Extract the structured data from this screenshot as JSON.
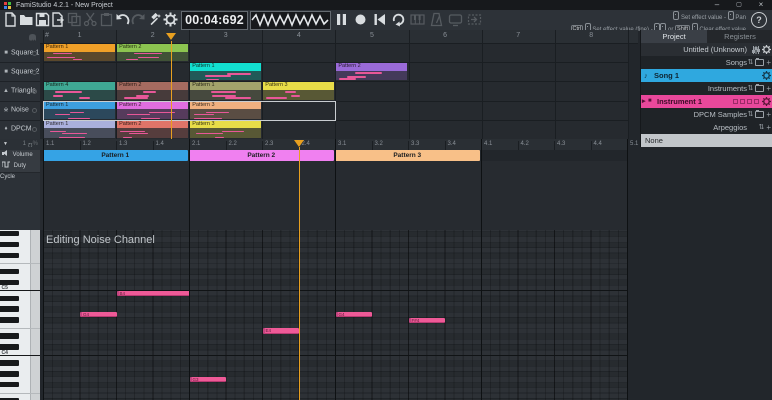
{
  "window": {
    "title": "FamiStudio 4.2.1 - New Project",
    "minimize": "–",
    "maximize": "▢",
    "close": "×"
  },
  "toolbar": {
    "buttons": [
      {
        "name": "new",
        "enabled": true
      },
      {
        "name": "open",
        "enabled": true
      },
      {
        "name": "save",
        "enabled": true
      },
      {
        "name": "export",
        "enabled": true
      },
      {
        "name": "copy",
        "enabled": false
      },
      {
        "name": "cut",
        "enabled": false
      },
      {
        "name": "paste",
        "enabled": false
      },
      {
        "name": "undo",
        "enabled": true
      },
      {
        "name": "redo",
        "enabled": false
      },
      {
        "name": "transform",
        "enabled": true
      },
      {
        "name": "settings",
        "enabled": true
      }
    ],
    "time_display": "00:04:692",
    "transport": [
      {
        "name": "pause",
        "enabled": true
      },
      {
        "name": "record",
        "enabled": true
      },
      {
        "name": "rewind",
        "enabled": true
      },
      {
        "name": "loop",
        "enabled": true
      },
      {
        "name": "qwerty-piano",
        "enabled": false
      },
      {
        "name": "metronome",
        "enabled": false
      },
      {
        "name": "machine",
        "enabled": false
      },
      {
        "name": "follow",
        "enabled": false
      }
    ],
    "hints": {
      "l1_action": "Set effect value",
      "l1_sep": "-",
      "l1_action2": "Pan",
      "l2_key": "Ctrl",
      "l2_action": "Set effect value (fine)",
      "l2_sep": "-",
      "l2_or": "or",
      "l2_key2": "Shift",
      "l2_action2": "Clear effect value",
      "help": "?"
    }
  },
  "sequencer": {
    "hash": "#",
    "columns": [
      "1",
      "2",
      "3",
      "4",
      "5",
      "6",
      "7",
      "8"
    ],
    "channels": [
      {
        "name": "Square 1",
        "icon": "■",
        "patterns": [
          {
            "col": 1,
            "name": "Pattern 1",
            "color": "#F0A028"
          },
          {
            "col": 2,
            "name": "Pattern 2",
            "color": "#8CC450"
          }
        ]
      },
      {
        "name": "Square 2",
        "icon": "■",
        "patterns": [
          {
            "col": 3,
            "name": "Pattern 1",
            "color": "#12DFD0"
          },
          {
            "col": 5,
            "name": "Pattern 2",
            "color": "#9A6AD8"
          }
        ]
      },
      {
        "name": "Triangle",
        "icon": "▲",
        "patterns": [
          {
            "col": 1,
            "name": "Pattern 4",
            "color": "#3FA894"
          },
          {
            "col": 2,
            "name": "Pattern 2",
            "color": "#A56B60"
          },
          {
            "col": 3,
            "name": "Pattern 1",
            "color": "#A3A36B"
          },
          {
            "col": 4,
            "name": "Pattern 3",
            "color": "#E8DC48"
          }
        ]
      },
      {
        "name": "Noise",
        "icon": "※",
        "patterns": [
          {
            "col": 1,
            "name": "Pattern 1",
            "color": "#3D9FE0"
          },
          {
            "col": 2,
            "name": "Pattern 2",
            "color": "#E06EE0"
          },
          {
            "col": 3,
            "name": "Pattern 3",
            "color": "#F0B080"
          }
        ]
      },
      {
        "name": "DPCM",
        "icon": "♦",
        "patterns": [
          {
            "col": 1,
            "name": "Pattern 1",
            "color": "#AAB0DC"
          },
          {
            "col": 2,
            "name": "Pattern 2",
            "color": "#E07468"
          },
          {
            "col": 3,
            "name": "Pattern 3",
            "color": "#E8DC48"
          }
        ]
      }
    ],
    "selection": {
      "channel": "Noise",
      "col_start": 1,
      "col_end": 4
    }
  },
  "right_panel": {
    "tabs": [
      {
        "label": "Project",
        "active": true
      },
      {
        "label": "Registers",
        "active": false
      }
    ],
    "project_name": "Untitled (Unknown)",
    "songs_header": "Songs",
    "song": {
      "name": "Song 1",
      "color": "#2FA8DF",
      "icon": "♪"
    },
    "instruments_header": "Instruments",
    "instrument": {
      "name": "Instrument 1",
      "color": "#E9489B",
      "expander": "▸",
      "icon": "■"
    },
    "dpcm_header": "DPCM Samples",
    "arpeggios_header": "Arpeggios",
    "arpeggio_none": "None",
    "sort_icon": "⇅"
  },
  "piano_roll": {
    "editing_label": "Editing Noise Channel",
    "snap": {
      "collapse": "▼",
      "value": "1",
      "percent": "%"
    },
    "effects": [
      "Volume",
      "Duty Cycle"
    ],
    "beats": [
      "1.1",
      "1.2",
      "1.3",
      "1.4",
      "2.1",
      "2.2",
      "2.3",
      "2.4",
      "3.1",
      "3.2",
      "3.3",
      "3.4",
      "4.1",
      "4.2",
      "4.3",
      "4.4",
      "5.1"
    ],
    "patterns": [
      {
        "name": "Pattern 1",
        "color": "#35A3E5"
      },
      {
        "name": "Pattern 2",
        "color": "#F080F0"
      },
      {
        "name": "Pattern 3",
        "color": "#F8C088"
      }
    ],
    "octave_labels": [
      {
        "label": "C5",
        "s": -1
      },
      {
        "label": "C4",
        "s": 11
      }
    ],
    "notes": [
      {
        "label": "G4",
        "start": 1,
        "beats": 1,
        "s": 4
      },
      {
        "label": "B4",
        "start": 2,
        "beats": 2,
        "s": 0
      },
      {
        "label": "G3",
        "start": 4,
        "beats": 1,
        "s": 16
      },
      {
        "label": "E4",
        "start": 6,
        "beats": 1,
        "s": 7
      },
      {
        "label": "G4",
        "start": 8,
        "beats": 1,
        "s": 4
      },
      {
        "label": "F#4",
        "start": 10,
        "beats": 1,
        "s": 5
      }
    ],
    "playhead_beat": 7
  },
  "colors": {
    "playhead": "#E8A020",
    "note": "#EE5A97",
    "selection": "#C9CDD1"
  }
}
